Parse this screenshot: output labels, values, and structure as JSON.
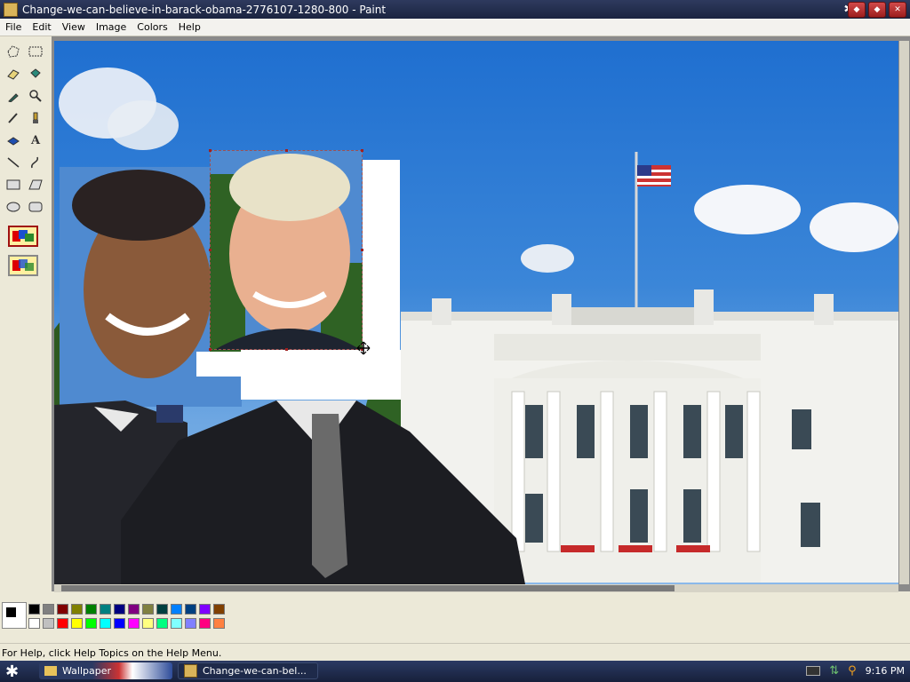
{
  "window": {
    "title": "Change-we-can-believe-in-barack-obama-2776107-1280-800 - Paint"
  },
  "menu": {
    "items": [
      "File",
      "Edit",
      "View",
      "Image",
      "Colors",
      "Help"
    ]
  },
  "tools": [
    "free-form-select",
    "select",
    "eraser",
    "fill",
    "pick-color",
    "magnifier",
    "pencil",
    "brush",
    "airbrush",
    "text",
    "line",
    "curve",
    "rectangle",
    "polygon",
    "ellipse",
    "rounded-rectangle"
  ],
  "palette": {
    "foreground": "#000000",
    "background": "#ffffff",
    "row1": [
      "#000000",
      "#808080",
      "#800000",
      "#808000",
      "#008000",
      "#008080",
      "#000080",
      "#800080",
      "#808040",
      "#004040",
      "#0080ff",
      "#004080",
      "#8000ff",
      "#804000"
    ],
    "row2": [
      "#ffffff",
      "#c0c0c0",
      "#ff0000",
      "#ffff00",
      "#00ff00",
      "#00ffff",
      "#0000ff",
      "#ff00ff",
      "#ffff80",
      "#00ff80",
      "#80ffff",
      "#8080ff",
      "#ff0080",
      "#ff8040"
    ]
  },
  "status": {
    "text": "For Help, click Help Topics on the Help Menu."
  },
  "taskbar": {
    "tasks": [
      "Wallpaper",
      "Change-we-can-bel..."
    ],
    "clock": "9:16 PM"
  }
}
